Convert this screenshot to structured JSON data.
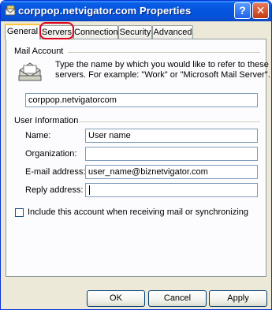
{
  "window": {
    "title": "corppop.netvigator.com Properties",
    "help_label": "?",
    "close_label": "✕"
  },
  "tabs": [
    {
      "label": "General",
      "active": true
    },
    {
      "label": "Servers",
      "highlighted": true
    },
    {
      "label": "Connection"
    },
    {
      "label": "Security"
    },
    {
      "label": "Advanced"
    }
  ],
  "mail_account": {
    "group_label": "Mail Account",
    "description_line1": "Type the name by which you would like to refer to these",
    "description_line2": "servers.  For example: \"Work\" or \"Microsoft Mail Server\".",
    "account_name": "corppop.netvigatorcom"
  },
  "user_info": {
    "group_label": "User Information",
    "name_label": "Name:",
    "name_value": "User name",
    "organization_label": "Organization:",
    "organization_value": "",
    "email_label": "E-mail address:",
    "email_value": "user_name@biznetvigator.com",
    "reply_label": "Reply address:",
    "reply_value": ""
  },
  "checkbox": {
    "label": "Include this account when receiving mail or synchronizing",
    "checked": false
  },
  "buttons": {
    "ok": "OK",
    "cancel": "Cancel",
    "apply": "Apply"
  },
  "colors": {
    "title_bar": "#0555e0",
    "highlight_ring": "#e0001b",
    "active_tab_accent": "#ffc83c"
  }
}
